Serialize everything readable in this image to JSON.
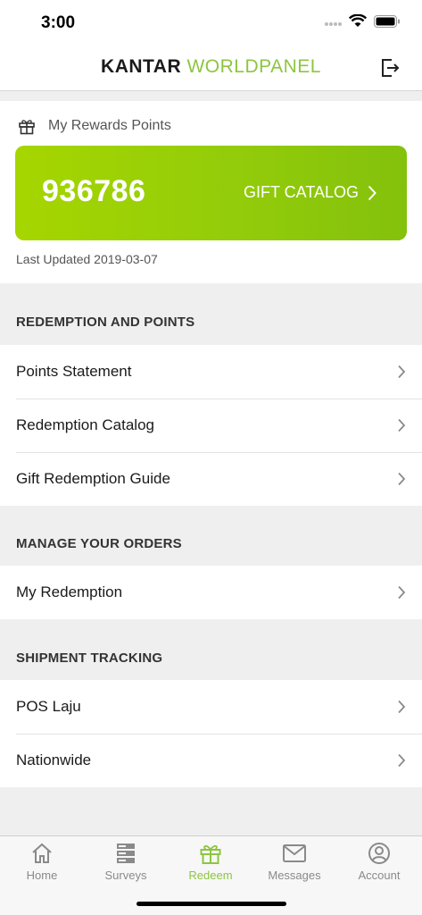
{
  "status": {
    "time": "3:00"
  },
  "header": {
    "brand_left": "KANTAR ",
    "brand_right": "WORLDPANEL"
  },
  "rewards": {
    "title": "My Rewards Points",
    "points": "936786",
    "catalog_label": "GIFT CATALOG",
    "last_updated": "Last Updated 2019-03-07"
  },
  "sections": [
    {
      "title": "REDEMPTION AND POINTS",
      "items": [
        "Points Statement",
        "Redemption Catalog",
        "Gift Redemption Guide"
      ]
    },
    {
      "title": "MANAGE YOUR ORDERS",
      "items": [
        "My Redemption"
      ]
    },
    {
      "title": "SHIPMENT TRACKING",
      "items": [
        "POS Laju",
        "Nationwide"
      ]
    }
  ],
  "tabs": [
    {
      "label": "Home",
      "icon": "home-icon"
    },
    {
      "label": "Surveys",
      "icon": "surveys-icon"
    },
    {
      "label": "Redeem",
      "icon": "gift-icon",
      "active": true
    },
    {
      "label": "Messages",
      "icon": "mail-icon"
    },
    {
      "label": "Account",
      "icon": "account-icon"
    }
  ],
  "colors": {
    "accent": "#8cc63f",
    "card_start": "#a6d600",
    "card_end": "#84c10c"
  }
}
